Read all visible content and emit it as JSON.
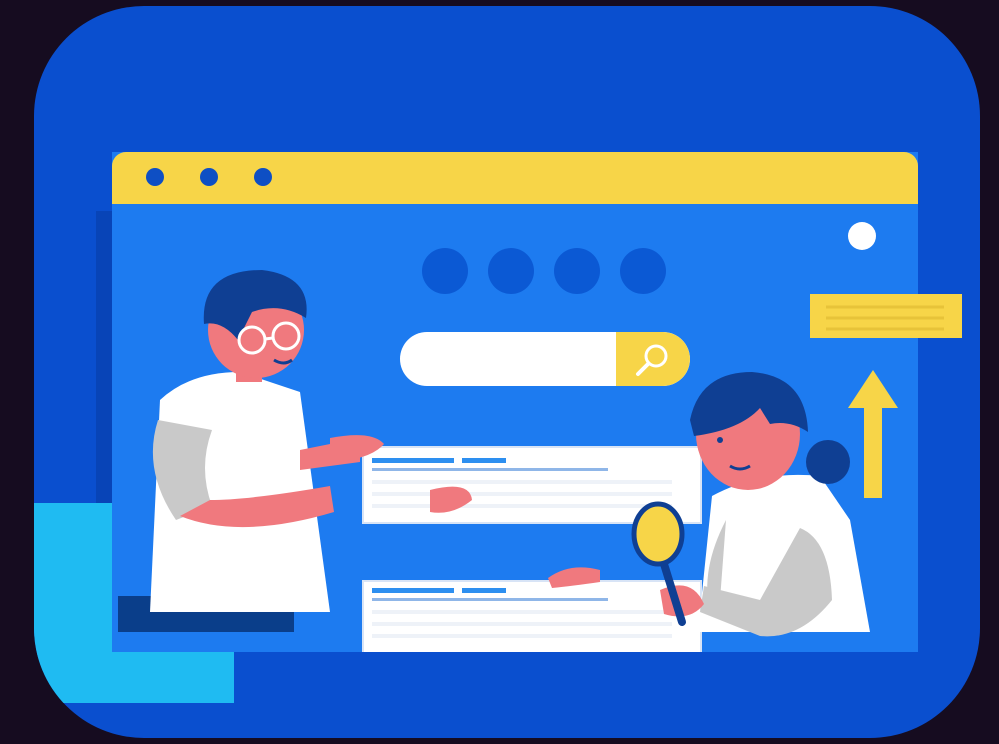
{
  "scene": {
    "subject": "search-engine-illustration",
    "colors": {
      "background": "#160c20",
      "card": "#0a4fcf",
      "browser": "#1d7bf0",
      "titlebar": "#f7d548",
      "accent": "#1fbbf2",
      "result_bar": "#2d8ff0"
    },
    "icons": [
      "magnifier-icon",
      "arrow-up-icon",
      "magnifying-glass-icon"
    ]
  }
}
